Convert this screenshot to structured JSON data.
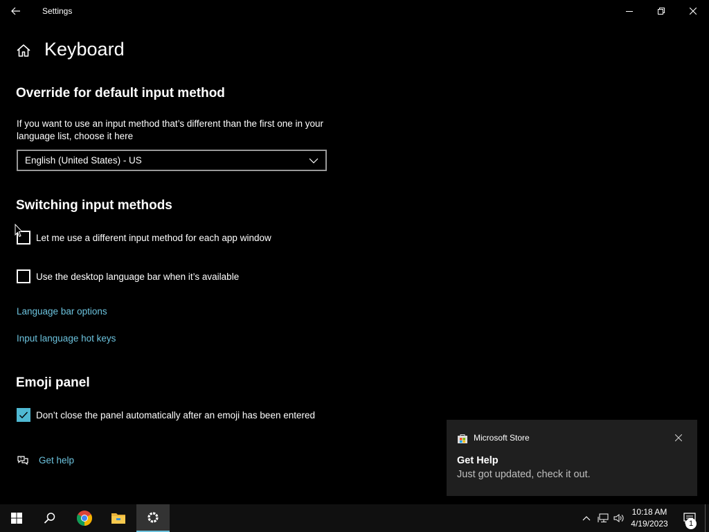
{
  "window": {
    "title": "Settings"
  },
  "header": {
    "page_title": "Keyboard"
  },
  "override_section": {
    "heading": "Override for default input method",
    "description": "If you want to use an input method that’s different than the first one in your language list, choose it here",
    "dropdown_value": "English (United States) - US"
  },
  "switching_section": {
    "heading": "Switching input methods",
    "option1_label": "Let me use a different input method for each app window",
    "option1_checked": false,
    "option2_label": "Use the desktop language bar when it’s available",
    "option2_checked": false,
    "link1": "Language bar options",
    "link2": "Input language hot keys"
  },
  "emoji_section": {
    "heading": "Emoji panel",
    "option_label": "Don’t close the panel automatically after an emoji has been entered",
    "option_checked": true
  },
  "help": {
    "label": "Get help"
  },
  "toast": {
    "app_name": "Microsoft Store",
    "title": "Get Help",
    "body": "Just got updated, check it out."
  },
  "taskbar": {
    "time": "10:18 AM",
    "date": "4/19/2023",
    "notification_count": "1"
  },
  "colors": {
    "accent": "#4fb9d3",
    "link": "#6cc3de",
    "background": "#000000"
  }
}
